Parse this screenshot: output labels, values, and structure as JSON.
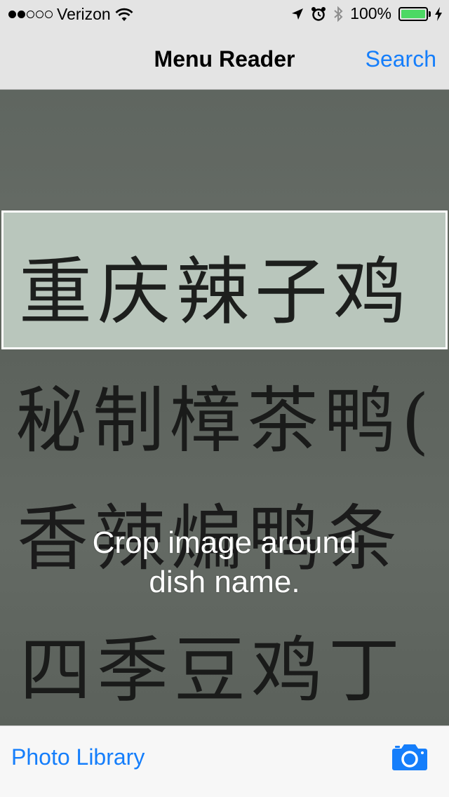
{
  "status_bar": {
    "carrier": "Verizon",
    "battery": "100%",
    "signal_bars_filled": 2,
    "signal_bars_total": 5,
    "battery_level": 1.0
  },
  "nav": {
    "title": "Menu Reader",
    "search_label": "Search"
  },
  "photo": {
    "crop_text": "重庆辣子鸡",
    "menu_lines": [
      "秘制樟茶鸭(",
      "香辣煸鸭条",
      "四季豆鸡丁"
    ]
  },
  "overlay": {
    "line1": "Crop image around",
    "line2": "dish name."
  },
  "toolbar": {
    "photo_library_label": "Photo Library"
  },
  "colors": {
    "accent": "#157efb",
    "battery_green": "#4cd964",
    "bar_background": "#e4e4e4"
  },
  "icons": {
    "wifi": "wifi-icon",
    "location": "location-arrow-icon",
    "alarm": "alarm-clock-icon",
    "bluetooth": "bluetooth-icon",
    "charging": "charging-bolt-icon",
    "camera": "camera-icon"
  }
}
